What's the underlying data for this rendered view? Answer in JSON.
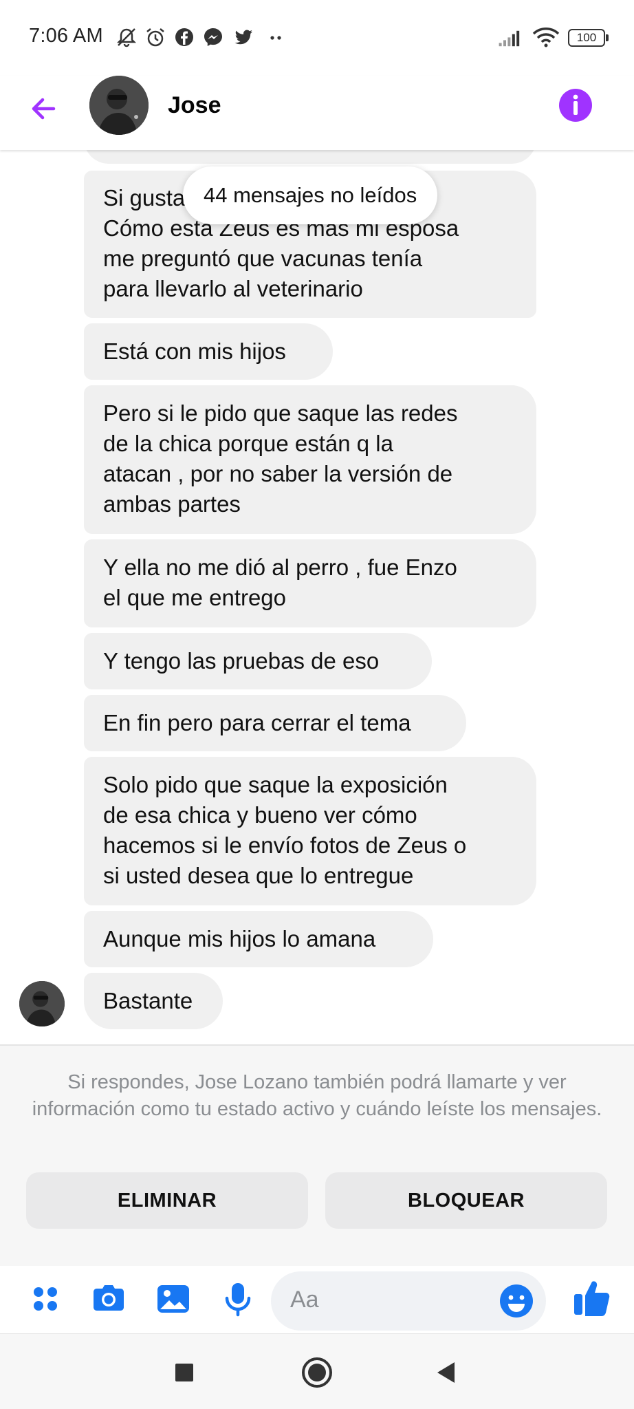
{
  "status_bar": {
    "time": "7:06 AM",
    "icons": [
      "muted-bell-icon",
      "alarm-icon",
      "facebook-icon",
      "messenger-icon",
      "twitter-icon",
      "more-dots-icon",
      "signal-icon",
      "wifi-icon"
    ],
    "battery": "100"
  },
  "header": {
    "contact_name": "Jose",
    "accent_color": "#a033ff"
  },
  "conversation": {
    "unread_pill": "44 mensajes no leídos",
    "messages": [
      {
        "text": "Si gusta hablamos del\n Cómo esta Zeus es mas mi esposa\nme preguntó que vacunas tenía\npara llevarlo al veterinario"
      },
      {
        "text": "Está con mis hijos"
      },
      {
        "text": "Pero si le pido que saque las redes\nde la chica porque están q la\natacan , por no saber la versión de\nambas partes"
      },
      {
        "text": "Y ella no me dió al perro , fue Enzo\nel que me entrego"
      },
      {
        "text": "Y tengo las pruebas de eso"
      },
      {
        "text": "En fin pero para cerrar el tema"
      },
      {
        "text": "Solo pido que saque la exposición\nde esa chica y bueno ver cómo\nhacemos si le envío fotos de Zeus o\nsi usted desea que lo entregue"
      },
      {
        "text": "Aunque mis hijos lo amana"
      },
      {
        "text": "Bastante"
      }
    ]
  },
  "request_panel": {
    "notice": "Si respondes, Jose Lozano también podrá llamarte y ver información como tu estado activo y cuándo leíste los mensajes.",
    "delete_label": "ELIMINAR",
    "block_label": "BLOQUEAR"
  },
  "composer": {
    "placeholder": "Aa",
    "icon_color": "#1877f2"
  },
  "nav_bar": {
    "icons": [
      "recents-square-icon",
      "home-circle-icon",
      "back-triangle-icon"
    ]
  }
}
